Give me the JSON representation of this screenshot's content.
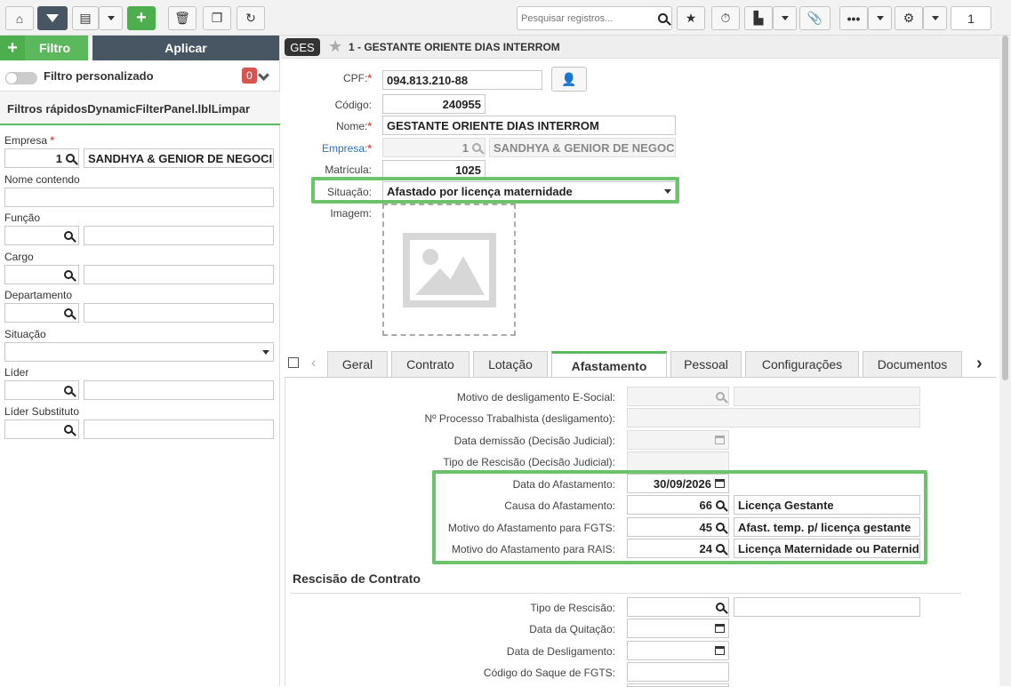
{
  "toolbar": {
    "search_placeholder": "Pesquisar registros...",
    "record_number": "1"
  },
  "left": {
    "filter_button": "Filtro",
    "apply_button": "Aplicar",
    "custom_filter_label": "Filtro personalizado",
    "custom_filter_count": "0",
    "quick_filters_title": "Filtros rápidosDynamicFilterPanel.lblLimpar",
    "empresa_label": "Empresa",
    "empresa_code": "1",
    "empresa_name": "SANDHYA & GENIOR DE NEGOCI",
    "nome_label": "Nome contendo",
    "funcao_label": "Função",
    "cargo_label": "Cargo",
    "departamento_label": "Departamento",
    "situacao_label": "Situação",
    "lider_label": "Líder",
    "lider_sub_label": "Líder Substituto"
  },
  "header": {
    "badge": "GES",
    "title": "1 - GESTANTE ORIENTE DIAS INTERROM"
  },
  "form": {
    "cpf_label": "CPF:",
    "cpf_value": "094.813.210-88",
    "codigo_label": "Código:",
    "codigo_value": "240955",
    "nome_label": "Nome:",
    "nome_value": "GESTANTE ORIENTE DIAS INTERROM",
    "empresa_label": "Empresa:",
    "empresa_code": "1",
    "empresa_name": "SANDHYA & GENIOR DE NEGOC",
    "matricula_label": "Matrícula:",
    "matricula_value": "1025",
    "situacao_label": "Situação:",
    "situacao_value": "Afastado por licença maternidade",
    "imagem_label": "Imagem:"
  },
  "tabs": [
    "Geral",
    "Contrato",
    "Lotação",
    "Afastamento",
    "Pessoal",
    "Configurações",
    "Documentos"
  ],
  "afastamento": {
    "motivo_deslig_label": "Motivo de desligamento E-Social:",
    "processo_label": "Nº Processo Trabalhista (desligamento):",
    "data_demissao_label": "Data demissão (Decisão Judicial):",
    "tipo_rescisao_jud_label": "Tipo de Rescisão (Decisão Judicial):",
    "data_afast_label": "Data do Afastamento:",
    "data_afast_value": "30/09/2026",
    "causa_label": "Causa do Afastamento:",
    "causa_code": "66",
    "causa_desc": "Licença Gestante",
    "fgts_label": "Motivo do Afastamento para FGTS:",
    "fgts_code": "45",
    "fgts_desc": "Afast. temp. p/ licença gestante",
    "rais_label": "Motivo do Afastamento para RAIS:",
    "rais_code": "24",
    "rais_desc": "Licença Maternidade ou Paternid"
  },
  "rescisao": {
    "section_title": "Rescisão de Contrato",
    "tipo_label": "Tipo de Rescisão:",
    "quitacao_label": "Data da Quitação:",
    "desligamento_label": "Data de Desligamento:",
    "saque_label": "Código do Saque de FGTS:"
  }
}
